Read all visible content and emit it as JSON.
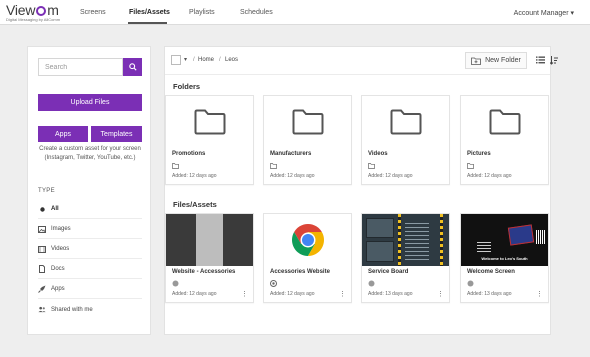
{
  "header": {
    "logo": "Viewcom",
    "logo_tagline": "Digital Messaging by AllComm",
    "nav": [
      "Screens",
      "Files/Assets",
      "Playlists",
      "Schedules"
    ],
    "account": "Account Manager"
  },
  "sidebar": {
    "search_placeholder": "Search",
    "upload_label": "Upload Files",
    "apps_label": "Apps",
    "templates_label": "Templates",
    "custom_text": "Create a custom asset for your screen (Instagram, Twitter, YouTube, etc.)",
    "type_heading": "TYPE",
    "types": [
      {
        "label": "All",
        "icon": "dot-icon"
      },
      {
        "label": "Images",
        "icon": "image-icon"
      },
      {
        "label": "Videos",
        "icon": "video-icon"
      },
      {
        "label": "Docs",
        "icon": "document-icon"
      },
      {
        "label": "Apps",
        "icon": "rocket-icon"
      },
      {
        "label": "Shared with me",
        "icon": "shared-users-icon"
      }
    ]
  },
  "toolbar": {
    "breadcrumb": [
      "Home",
      "Leos"
    ],
    "new_folder": "New Folder"
  },
  "folders_title": "Folders",
  "folders": [
    {
      "name": "Promotions",
      "added": "Added: 12 days ago"
    },
    {
      "name": "Manufacturers",
      "added": "Added: 12 days ago"
    },
    {
      "name": "Videos",
      "added": "Added: 12 days ago"
    },
    {
      "name": "Pictures",
      "added": "Added: 12 days ago"
    }
  ],
  "files_title": "Files/Assets",
  "files": [
    {
      "name": "Website - Accessories",
      "added": "Added: 12 days ago"
    },
    {
      "name": "Accessories Website",
      "added": "Added: 12 days ago"
    },
    {
      "name": "Service Board",
      "added": "Added: 13 days ago"
    },
    {
      "name": "Welcome Screen",
      "added": "Added: 13 days ago",
      "thumb_text": "Welcome to Leo's South"
    }
  ],
  "colors": {
    "accent": "#7b2fb5"
  }
}
